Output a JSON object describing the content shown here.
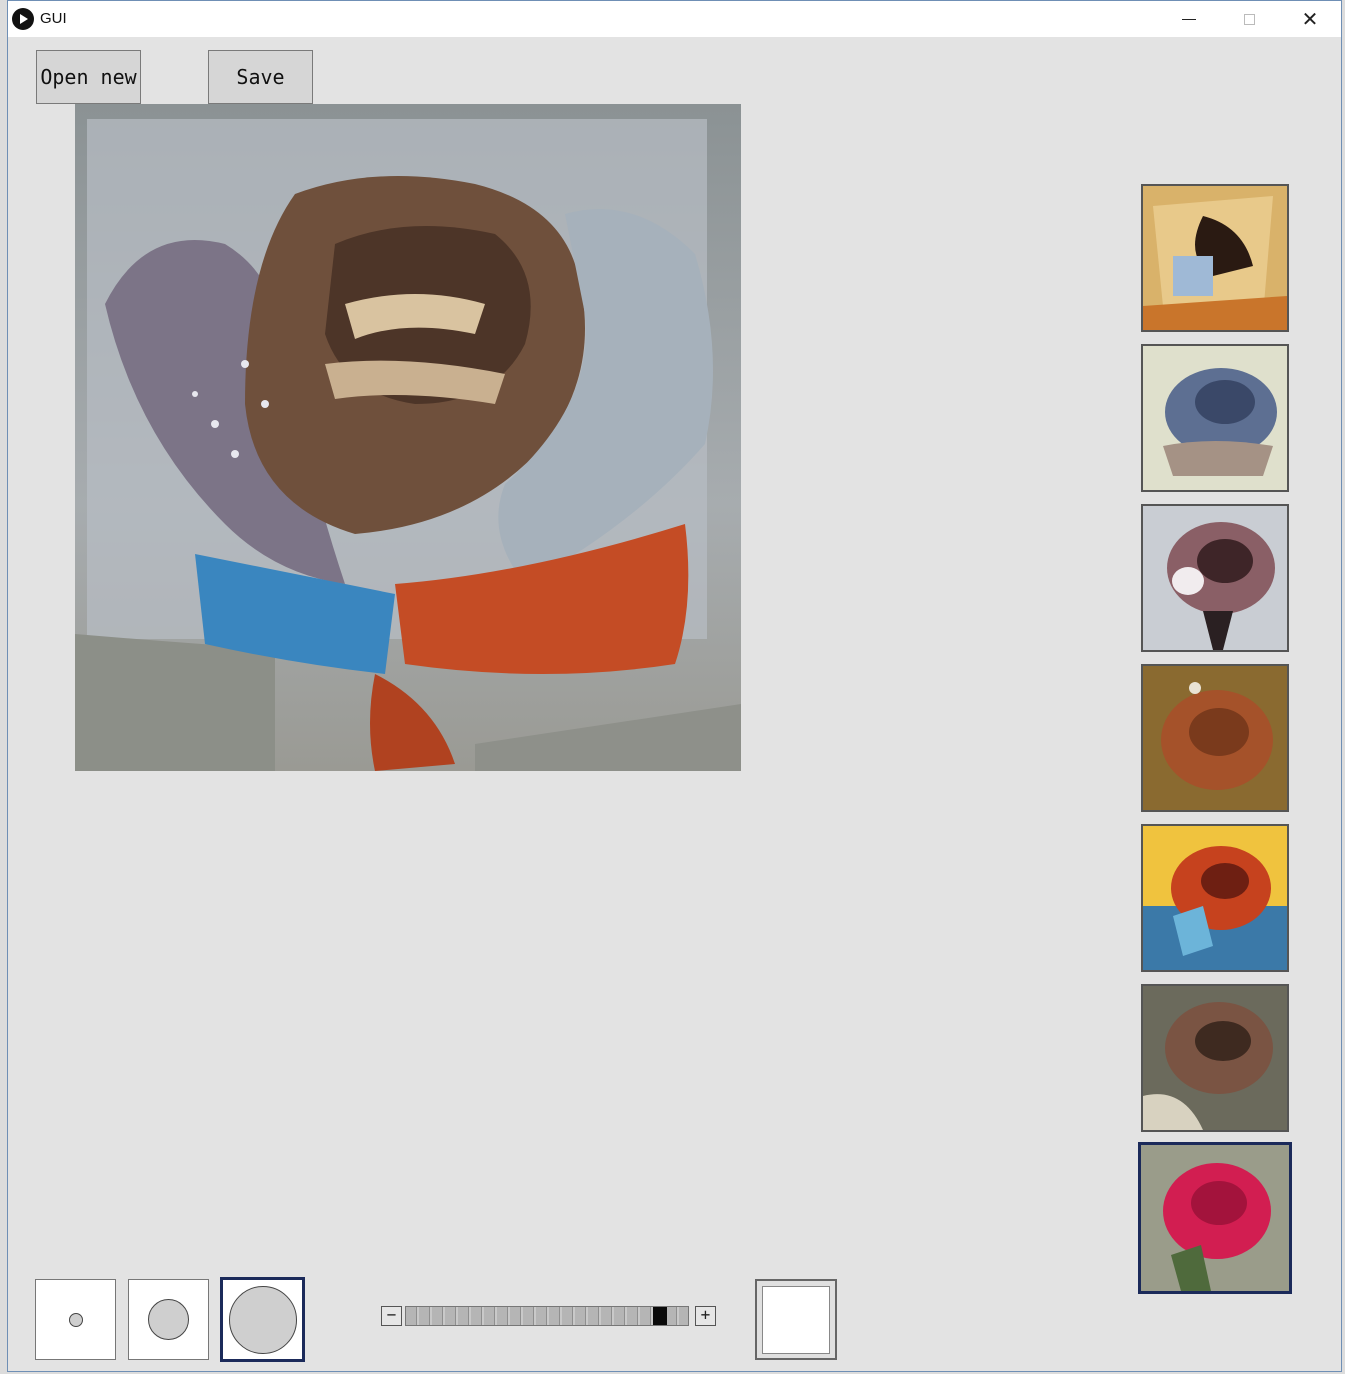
{
  "window": {
    "title": "GUI",
    "minimize_glyph": "",
    "close_glyph": "✕"
  },
  "toolbar": {
    "open_label": "Open new",
    "save_label": "Save"
  },
  "canvas": {
    "content": "stylized-rose-image"
  },
  "style_thumbnails": [
    {
      "name": "style-abstract-yellow",
      "selected": false
    },
    {
      "name": "style-blue-rose",
      "selected": false
    },
    {
      "name": "style-pink-grey-rose",
      "selected": false
    },
    {
      "name": "style-orange-textured-rose",
      "selected": false
    },
    {
      "name": "style-cubist-rose",
      "selected": false
    },
    {
      "name": "style-brown-rose",
      "selected": false
    },
    {
      "name": "style-red-rose-photo",
      "selected": true
    }
  ],
  "brush_sizes": [
    {
      "name": "small",
      "selected": false
    },
    {
      "name": "medium",
      "selected": false
    },
    {
      "name": "large",
      "selected": true
    }
  ],
  "slider": {
    "minus_glyph": "−",
    "plus_glyph": "+",
    "value": 0.92
  },
  "color": {
    "current": "#ffffff"
  }
}
